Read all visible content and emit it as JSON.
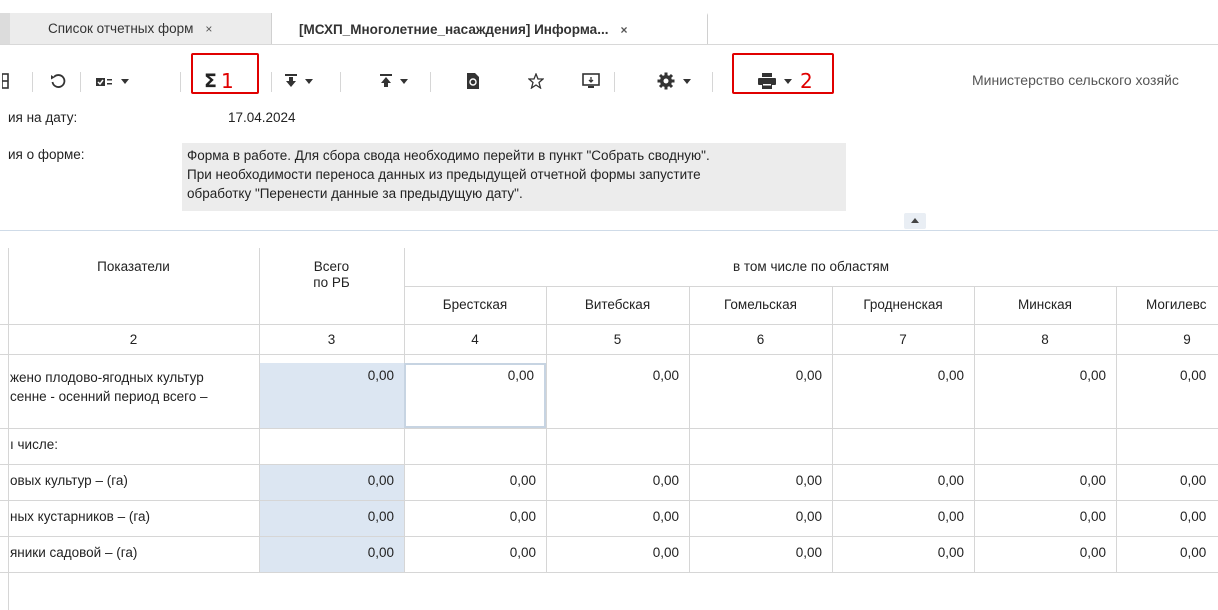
{
  "tabs": [
    {
      "label": "Список отчетных форм",
      "close": "×"
    },
    {
      "label": "[МСХП_Многолетние_насаждения] Информа...",
      "close": "×"
    }
  ],
  "toolbar": {
    "annotation_1": "1",
    "annotation_2": "2",
    "ministry": "Министерство сельского хозяйс"
  },
  "form": {
    "date_label": "ия на дату:",
    "date_value": "17.04.2024",
    "info_label": "ия о форме:",
    "info_lines": [
      "Форма в работе. Для сбора свода необходимо перейти в пункт \"Собрать сводную\".",
      "При необходимости переноса данных из предыдущей отчетной формы запустите",
      "обработку \"Перенести данные за предыдущую дату\"."
    ]
  },
  "table": {
    "header": {
      "indicators": "Показатели",
      "total_1": "Всего",
      "total_2": "по РБ",
      "regions_group": "в том числе по областям",
      "regions": [
        "Брестская",
        "Витебская",
        "Гомельская",
        "Гродненская",
        "Минская",
        "Могилевс"
      ]
    },
    "col_numbers": [
      "2",
      "3",
      "4",
      "5",
      "6",
      "7",
      "8",
      "9"
    ],
    "rows": [
      {
        "label_1": "жено плодово-ягодных культур",
        "label_2": "сенне - осенний период всего –",
        "values": [
          "0,00",
          "0,00",
          "0,00",
          "0,00",
          "0,00",
          "0,00",
          "0,00"
        ]
      },
      {
        "label_1": "ı числе:",
        "label_2": "",
        "values": [
          "",
          "",
          "",
          "",
          "",
          "",
          ""
        ]
      },
      {
        "label_1": "овых культур – (га)",
        "label_2": "",
        "values": [
          "0,00",
          "0,00",
          "0,00",
          "0,00",
          "0,00",
          "0,00",
          "0,00"
        ]
      },
      {
        "label_1": "ных кустарников – (га)",
        "label_2": "",
        "values": [
          "0,00",
          "0,00",
          "0,00",
          "0,00",
          "0,00",
          "0,00",
          "0,00"
        ]
      },
      {
        "label_1": "яники садовой – (га)",
        "label_2": "",
        "values": [
          "0,00",
          "0,00",
          "0,00",
          "0,00",
          "0,00",
          "0,00",
          "0,00"
        ]
      }
    ]
  },
  "colors": {
    "accent_red": "#e00000",
    "blue_cell": "#dce6f2",
    "info_bg": "#ececec"
  }
}
